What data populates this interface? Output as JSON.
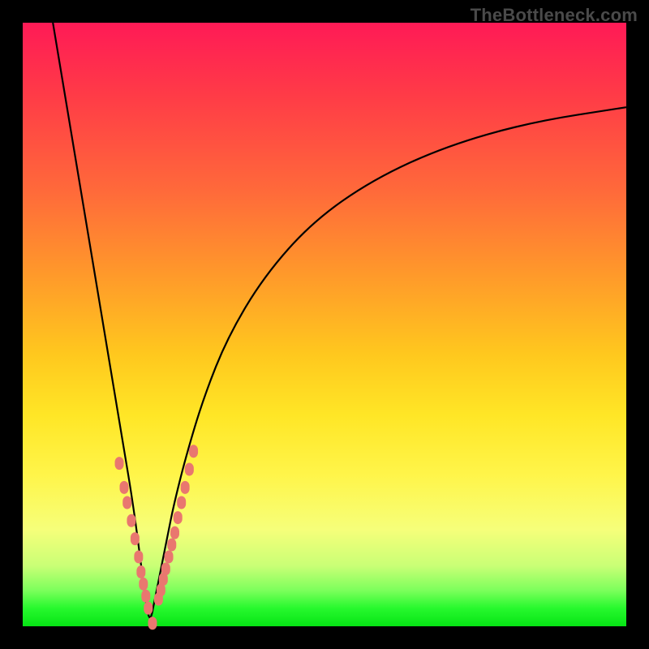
{
  "watermark": "TheBottleneck.com",
  "colors": {
    "background": "#000000",
    "gradient_top": "#ff1a56",
    "gradient_bottom": "#06e414",
    "curve": "#000000",
    "marker": "#e9776f"
  },
  "chart_data": {
    "type": "line",
    "title": "",
    "xlabel": "",
    "ylabel": "",
    "xlim": [
      0,
      100
    ],
    "ylim": [
      0,
      100
    ],
    "vertex_x": 21,
    "series": [
      {
        "name": "curve",
        "x": [
          5,
          7,
          9,
          11,
          13,
          15,
          17,
          18,
          19,
          20,
          21,
          22,
          23,
          24,
          25,
          27,
          30,
          34,
          40,
          48,
          58,
          70,
          84,
          100
        ],
        "values": [
          100,
          88,
          76,
          64,
          52,
          40,
          28,
          22,
          15,
          7,
          0,
          5,
          10,
          15,
          20,
          28,
          38,
          48,
          58,
          67,
          74,
          79.5,
          83.5,
          86
        ]
      }
    ],
    "markers": {
      "name": "highlighted-points",
      "x": [
        16,
        16.8,
        17.3,
        18.0,
        18.6,
        19.2,
        19.6,
        20.0,
        20.4,
        20.8,
        21.5,
        22.5,
        22.9,
        23.3,
        23.7,
        24.2,
        24.7,
        25.2,
        25.7,
        26.3,
        26.9,
        27.6,
        28.3
      ],
      "values": [
        27,
        23,
        20.5,
        17.5,
        14.5,
        11.5,
        9,
        7,
        5,
        3,
        0.5,
        4.5,
        6,
        7.8,
        9.5,
        11.5,
        13.5,
        15.5,
        18,
        20.5,
        23,
        26,
        29
      ]
    }
  }
}
